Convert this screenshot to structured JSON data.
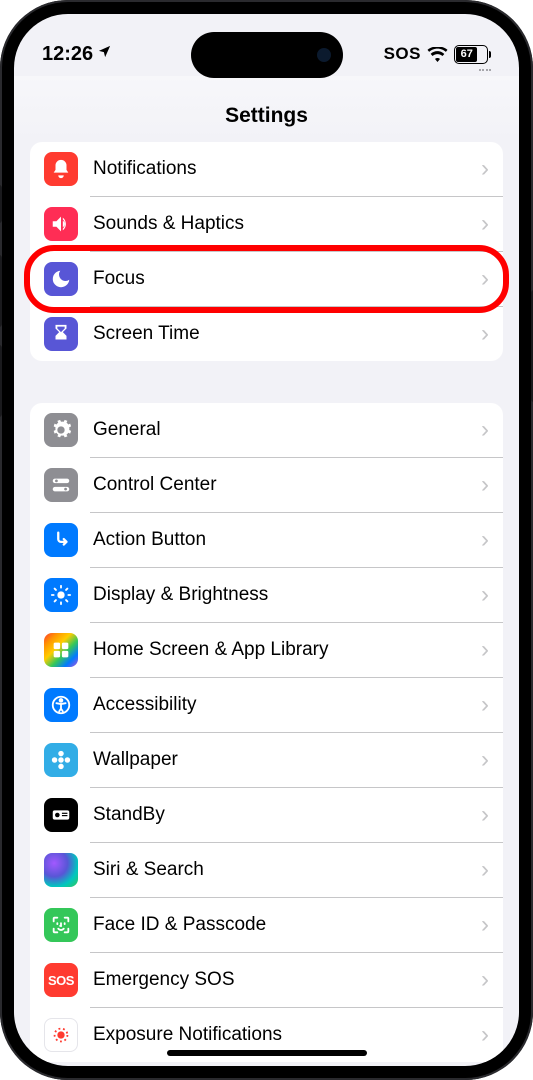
{
  "status": {
    "time": "12:26",
    "sos": "SOS",
    "battery": "67"
  },
  "header": {
    "title": "Settings"
  },
  "sections": [
    {
      "items": [
        {
          "label": "Notifications"
        },
        {
          "label": "Sounds & Haptics"
        },
        {
          "label": "Focus"
        },
        {
          "label": "Screen Time"
        }
      ]
    },
    {
      "items": [
        {
          "label": "General"
        },
        {
          "label": "Control Center"
        },
        {
          "label": "Action Button"
        },
        {
          "label": "Display & Brightness"
        },
        {
          "label": "Home Screen & App Library"
        },
        {
          "label": "Accessibility"
        },
        {
          "label": "Wallpaper"
        },
        {
          "label": "StandBy"
        },
        {
          "label": "Siri & Search"
        },
        {
          "label": "Face ID & Passcode"
        },
        {
          "label": "Emergency SOS"
        },
        {
          "label": "Exposure Notifications"
        }
      ]
    }
  ]
}
